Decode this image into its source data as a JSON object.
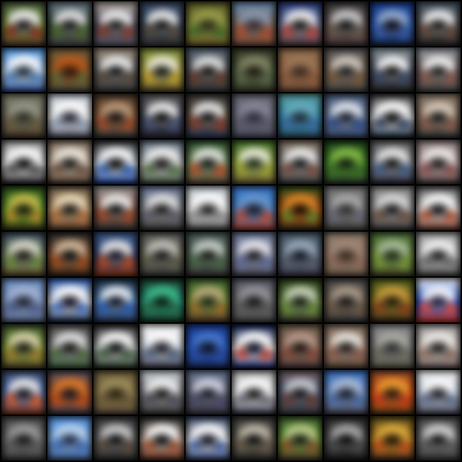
{
  "grid": {
    "rows": 10,
    "cols": 10,
    "background": "#000000",
    "tiles": [
      {
        "top": "#4a5a3a",
        "mid": "#6a8a3a",
        "bottom": "#5a3a2a",
        "blob": "#f2f2f2",
        "dark": "#1a1a1a",
        "accent": "#8a2a1a"
      },
      {
        "top": "#6a7a8a",
        "mid": "#3a4a3a",
        "bottom": "#4a4a4a",
        "blob": "#e8e8e8",
        "dark": "#151515",
        "accent": "#4a6a2a"
      },
      {
        "top": "#b0a8a0",
        "mid": "#4a4a5a",
        "bottom": "#5a5a6a",
        "blob": "#f4f4f4",
        "dark": "#1a1a1a",
        "accent": "#8a3a2a"
      },
      {
        "top": "#3a4a6a",
        "mid": "#2a3a4a",
        "bottom": "#3a3a3a",
        "blob": "#f0f0f0",
        "dark": "#101010",
        "accent": "#5a4a3a"
      },
      {
        "top": "#5a5a2a",
        "mid": "#8a8a3a",
        "bottom": "#6a5a2a",
        "blob": "#9aa04a",
        "dark": "#2a2a1a",
        "accent": "#3a6a2a"
      },
      {
        "top": "#6a8ab0",
        "mid": "#7a6a5a",
        "bottom": "#7a4a3a",
        "blob": "#8a9ab0",
        "dark": "#3a2a2a",
        "accent": "#b04a2a"
      },
      {
        "top": "#2a3a7a",
        "mid": "#6a7aa0",
        "bottom": "#5a3a3a",
        "blob": "#f2f2f2",
        "dark": "#151515",
        "accent": "#c04030"
      },
      {
        "top": "#3a3a3a",
        "mid": "#5a4a4a",
        "bottom": "#4a3a3a",
        "blob": "#d0d0d0",
        "dark": "#101010",
        "accent": "#6a5a4a"
      },
      {
        "top": "#1a3a8a",
        "mid": "#2a5ab0",
        "bottom": "#1a2a4a",
        "blob": "#9ab0d0",
        "dark": "#0a0a1a",
        "accent": "#3a5aa0"
      },
      {
        "top": "#4a5a6a",
        "mid": "#4a4a4a",
        "bottom": "#2a2a2a",
        "blob": "#f6f6f6",
        "dark": "#151515",
        "accent": "#6a4a3a"
      },
      {
        "top": "#4a90d8",
        "mid": "#c0d8f0",
        "bottom": "#2a4a8a",
        "blob": "#ffffff",
        "dark": "#1a2a3a",
        "accent": "#4a7ab0"
      },
      {
        "top": "#6a5a3a",
        "mid": "#8a5a2a",
        "bottom": "#4a4a3a",
        "blob": "#c05a1a",
        "dark": "#2a1a10",
        "accent": "#5a6a3a"
      },
      {
        "top": "#a09080",
        "mid": "#5a5a5a",
        "bottom": "#3a3a3a",
        "blob": "#f4f4f4",
        "dark": "#101010",
        "accent": "#5a4a3a"
      },
      {
        "top": "#7a8a3a",
        "mid": "#a09a3a",
        "bottom": "#5a4a2a",
        "blob": "#f0f0e0",
        "dark": "#151510",
        "accent": "#c0a030"
      },
      {
        "top": "#5a6a7a",
        "mid": "#4a4a4a",
        "bottom": "#3a3a3a",
        "blob": "#e8e8e8",
        "dark": "#101010",
        "accent": "#6a3a2a"
      },
      {
        "top": "#3a3a2a",
        "mid": "#4a5a3a",
        "bottom": "#3a3a2a",
        "blob": "#8a8a6a",
        "dark": "#1a1a10",
        "accent": "#5a6a4a"
      },
      {
        "top": "#8a6a4a",
        "mid": "#9a6a4a",
        "bottom": "#6a4a3a",
        "blob": "#a07a5a",
        "dark": "#3a2a20",
        "accent": "#8a5a3a"
      },
      {
        "top": "#5a5a5a",
        "mid": "#6a5a4a",
        "bottom": "#4a4a4a",
        "blob": "#d8d0c8",
        "dark": "#1a1a1a",
        "accent": "#7a5a3a"
      },
      {
        "top": "#8a9aa0",
        "mid": "#4a4a5a",
        "bottom": "#2a2a2a",
        "blob": "#ffffff",
        "dark": "#101010",
        "accent": "#3a4a6a"
      },
      {
        "top": "#9aa0a8",
        "mid": "#6a5a5a",
        "bottom": "#4a4a4a",
        "blob": "#f8f8f8",
        "dark": "#1a1a1a",
        "accent": "#8a5a4a"
      },
      {
        "top": "#7a7a6a",
        "mid": "#6a6a5a",
        "bottom": "#4a3a2a",
        "blob": "#9a9a8a",
        "dark": "#2a2a20",
        "accent": "#6a5a3a"
      },
      {
        "top": "#c0c8d0",
        "mid": "#f0f0f0",
        "bottom": "#4a4a5a",
        "blob": "#ffffff",
        "dark": "#202030",
        "accent": "#8a9ab0"
      },
      {
        "top": "#4a3a2a",
        "mid": "#8a5a3a",
        "bottom": "#3a3a3a",
        "blob": "#c0a080",
        "dark": "#151010",
        "accent": "#a04a2a"
      },
      {
        "top": "#5a5a5a",
        "mid": "#3a3a4a",
        "bottom": "#2a2a3a",
        "blob": "#f4f4f4",
        "dark": "#0a0a0a",
        "accent": "#4a5a7a"
      },
      {
        "top": "#3a3a3a",
        "mid": "#5a4a3a",
        "bottom": "#2a3a5a",
        "blob": "#f0f0f0",
        "dark": "#101010",
        "accent": "#8a3a2a"
      },
      {
        "top": "#6a6a7a",
        "mid": "#6a6a7a",
        "bottom": "#4a4a5a",
        "blob": "#8a8a9a",
        "dark": "#2a2a3a",
        "accent": "#5a5a6a"
      },
      {
        "top": "#5aa0a0",
        "mid": "#3a8ab0",
        "bottom": "#2a4a5a",
        "blob": "#6ab0c0",
        "dark": "#1a2a3a",
        "accent": "#3a6aa0"
      },
      {
        "top": "#4a5a7a",
        "mid": "#6a7a9a",
        "bottom": "#3a4a6a",
        "blob": "#e8eef4",
        "dark": "#151a2a",
        "accent": "#2a4a8a"
      },
      {
        "top": "#3a3a3a",
        "mid": "#f4f4f4",
        "bottom": "#1a2a3a",
        "blob": "#ffffff",
        "dark": "#0a0a0a",
        "accent": "#2a3a5a"
      },
      {
        "top": "#8a7a6a",
        "mid": "#7a6a5a",
        "bottom": "#3a3a3a",
        "blob": "#e0d0c0",
        "dark": "#151515",
        "accent": "#8a5a4a"
      },
      {
        "top": "#8a8a8a",
        "mid": "#f8f8f8",
        "bottom": "#2a2a2a",
        "blob": "#ffffff",
        "dark": "#0a0a0a",
        "accent": "#4a4a4a"
      },
      {
        "top": "#7a6a5a",
        "mid": "#d0c0b0",
        "bottom": "#4a3a2a",
        "blob": "#f2ece4",
        "dark": "#1a1510",
        "accent": "#6a4a3a"
      },
      {
        "top": "#2a2a2a",
        "mid": "#e0e8f0",
        "bottom": "#1a3a8a",
        "blob": "#ffffff",
        "dark": "#0a0a0a",
        "accent": "#2a5ab0"
      },
      {
        "top": "#5a6a7a",
        "mid": "#d8d8d8",
        "bottom": "#3a4a3a",
        "blob": "#f4f4f4",
        "dark": "#151515",
        "accent": "#4a6a3a"
      },
      {
        "top": "#2a4a2a",
        "mid": "#6a8a5a",
        "bottom": "#5a4a3a",
        "blob": "#e8ece4",
        "dark": "#101a10",
        "accent": "#c04a2a"
      },
      {
        "top": "#3a6a2a",
        "mid": "#8aa03a",
        "bottom": "#6a5a3a",
        "blob": "#f0f0e0",
        "dark": "#1a2a10",
        "accent": "#a0a030"
      },
      {
        "top": "#7a6a5a",
        "mid": "#8a8a8a",
        "bottom": "#3a3a3a",
        "blob": "#f4f4f4",
        "dark": "#151515",
        "accent": "#7a4a3a"
      },
      {
        "top": "#1a3a1a",
        "mid": "#4a8a2a",
        "bottom": "#2a3a2a",
        "blob": "#8ac04a",
        "dark": "#0a1a0a",
        "accent": "#3a6a2a"
      },
      {
        "top": "#5a5a5a",
        "mid": "#8a8a8a",
        "bottom": "#2a2a3a",
        "blob": "#f0f0f0",
        "dark": "#101010",
        "accent": "#3a5a8a"
      },
      {
        "top": "#8a7a7a",
        "mid": "#c0b0b0",
        "bottom": "#4a3a3a",
        "blob": "#f6f0f0",
        "dark": "#1a1515",
        "accent": "#8a4a4a"
      },
      {
        "top": "#2a4a1a",
        "mid": "#5a9a2a",
        "bottom": "#3a3a1a",
        "blob": "#d0c050",
        "dark": "#101a0a",
        "accent": "#c08a2a"
      },
      {
        "top": "#6a5a4a",
        "mid": "#c0a070",
        "bottom": "#5a3a2a",
        "blob": "#f0e0c0",
        "dark": "#1a1510",
        "accent": "#b06a3a"
      },
      {
        "top": "#9a9a9a",
        "mid": "#7a4a3a",
        "bottom": "#3a3a3a",
        "blob": "#f4f4f4",
        "dark": "#101010",
        "accent": "#a04a2a"
      },
      {
        "top": "#6a7a9a",
        "mid": "#8a8a8a",
        "bottom": "#3a3a3a",
        "blob": "#e8e8e8",
        "dark": "#151515",
        "accent": "#5a5a6a"
      },
      {
        "top": "#c0c8d0",
        "mid": "#f0f0f0",
        "bottom": "#4a4a4a",
        "blob": "#ffffff",
        "dark": "#1a1a1a",
        "accent": "#8a8a8a"
      },
      {
        "top": "#3a70c0",
        "mid": "#4a8ad0",
        "bottom": "#a03a2a",
        "blob": "#6a9ad0",
        "dark": "#1a1a2a",
        "accent": "#c04a2a"
      },
      {
        "top": "#2a4a1a",
        "mid": "#c05a1a",
        "bottom": "#3a2a1a",
        "blob": "#e08a2a",
        "dark": "#150a05",
        "accent": "#5a8a2a"
      },
      {
        "top": "#7a7a7a",
        "mid": "#6a6a6a",
        "bottom": "#4a4a4a",
        "blob": "#b0b0b0",
        "dark": "#2a2a2a",
        "accent": "#6a6a7a"
      },
      {
        "top": "#8a8a8a",
        "mid": "#9a9a9a",
        "bottom": "#3a3a3a",
        "blob": "#e0e0e0",
        "dark": "#151515",
        "accent": "#6a4a3a"
      },
      {
        "top": "#5a5a5a",
        "mid": "#e0e0e0",
        "bottom": "#6a3a2a",
        "blob": "#ffffff",
        "dark": "#101010",
        "accent": "#b04a2a"
      },
      {
        "top": "#3a4a5a",
        "mid": "#7a8a6a",
        "bottom": "#5a4a2a",
        "blob": "#e0e0d0",
        "dark": "#151510",
        "accent": "#6a8a3a"
      },
      {
        "top": "#2a2a2a",
        "mid": "#8a5a3a",
        "bottom": "#3a2a1a",
        "blob": "#d8c0a0",
        "dark": "#0a0a0a",
        "accent": "#a04a1a"
      },
      {
        "top": "#3a5a8a",
        "mid": "#2a3a6a",
        "bottom": "#8a3a1a",
        "blob": "#f0f0f0",
        "dark": "#101020",
        "accent": "#c04a1a"
      },
      {
        "top": "#5a5a5a",
        "mid": "#6a6a5a",
        "bottom": "#3a3a3a",
        "blob": "#c8c8c0",
        "dark": "#151515",
        "accent": "#5a5a4a"
      },
      {
        "top": "#4a5a5a",
        "mid": "#4a5a4a",
        "bottom": "#3a3a3a",
        "blob": "#d0d8d0",
        "dark": "#101510",
        "accent": "#4a6a4a"
      },
      {
        "top": "#6a7a9a",
        "mid": "#8a8aa0",
        "bottom": "#4a4a5a",
        "blob": "#f0f0f4",
        "dark": "#151520",
        "accent": "#5a6a9a"
      },
      {
        "top": "#4a5a6a",
        "mid": "#5a6a7a",
        "bottom": "#3a3a4a",
        "blob": "#a0b0c0",
        "dark": "#101520",
        "accent": "#5a5a6a"
      },
      {
        "top": "#8a7a6a",
        "mid": "#9a7a6a",
        "bottom": "#6a5a4a",
        "blob": "#a08a7a",
        "dark": "#3a2a20",
        "accent": "#8a6a5a"
      },
      {
        "top": "#4a6a3a",
        "mid": "#6a8a3a",
        "bottom": "#4a4a2a",
        "blob": "#b0c0a0",
        "dark": "#1a2a10",
        "accent": "#7a9a3a"
      },
      {
        "top": "#a0a0a0",
        "mid": "#c8c8c8",
        "bottom": "#4a4a4a",
        "blob": "#f8f8f8",
        "dark": "#1a1a1a",
        "accent": "#6a6a6a"
      },
      {
        "top": "#6a8ac0",
        "mid": "#8aa0c8",
        "bottom": "#5a6a8a",
        "blob": "#a8b8d8",
        "dark": "#1a2030",
        "accent": "#4a5a8a"
      },
      {
        "top": "#2a5ab0",
        "mid": "#f4f4f4",
        "bottom": "#1a2a4a",
        "blob": "#ffffff",
        "dark": "#0a0a1a",
        "accent": "#3a6ac0"
      },
      {
        "top": "#1a2a3a",
        "mid": "#4a7ab0",
        "bottom": "#2a3a5a",
        "blob": "#f0f4f8",
        "dark": "#0a1020",
        "accent": "#2a5ab0"
      },
      {
        "top": "#1a3a2a",
        "mid": "#2a9a7a",
        "bottom": "#1a3a2a",
        "blob": "#40c090",
        "dark": "#0a1a10",
        "accent": "#2a6a4a"
      },
      {
        "top": "#3a5a2a",
        "mid": "#6a8a3a",
        "bottom": "#5a3a2a",
        "blob": "#c0b080",
        "dark": "#1a2a10",
        "accent": "#a06a2a"
      },
      {
        "top": "#5a5a6a",
        "mid": "#6a6a6a",
        "bottom": "#4a4a4a",
        "blob": "#9a9aa0",
        "dark": "#151515",
        "accent": "#5a5a5a"
      },
      {
        "top": "#2a3a1a",
        "mid": "#6a8a4a",
        "bottom": "#3a3a2a",
        "blob": "#d0d8c0",
        "dark": "#101a0a",
        "accent": "#6a8a3a"
      },
      {
        "top": "#4a4a4a",
        "mid": "#6a5a4a",
        "bottom": "#3a3a3a",
        "blob": "#b0a090",
        "dark": "#151515",
        "accent": "#6a5a4a"
      },
      {
        "top": "#4a5a1a",
        "mid": "#8a7a2a",
        "bottom": "#3a2a1a",
        "blob": "#d0a040",
        "dark": "#1a1a0a",
        "accent": "#8a3a1a"
      },
      {
        "top": "#f0f4f8",
        "mid": "#2a5ad0",
        "bottom": "#c03a2a",
        "blob": "#ffffff",
        "dark": "#1a1a3a",
        "accent": "#e04a3a"
      },
      {
        "top": "#3a4a2a",
        "mid": "#7a9a3a",
        "bottom": "#5a4a2a",
        "blob": "#e0d8b0",
        "dark": "#151a0a",
        "accent": "#a07a2a"
      },
      {
        "top": "#4a4a4a",
        "mid": "#8a8a8a",
        "bottom": "#3a5a3a",
        "blob": "#e8e8e8",
        "dark": "#101010",
        "accent": "#4a6a3a"
      },
      {
        "top": "#2a2a2a",
        "mid": "#d0d0d0",
        "bottom": "#2a3a2a",
        "blob": "#ffffff",
        "dark": "#0a0a0a",
        "accent": "#3a5a3a"
      },
      {
        "top": "#f8f8f8",
        "mid": "#d0d8e0",
        "bottom": "#3a3a4a",
        "blob": "#ffffff",
        "dark": "#151520",
        "accent": "#4a5a7a"
      },
      {
        "top": "#1a3a8a",
        "mid": "#2a5ac0",
        "bottom": "#1a2a5a",
        "blob": "#4a7ad0",
        "dark": "#0a1020",
        "accent": "#2a4aa0"
      },
      {
        "top": "#0a1a4a",
        "mid": "#f0f0f0",
        "bottom": "#1a2a6a",
        "blob": "#ffffff",
        "dark": "#050a20",
        "accent": "#c03a2a"
      },
      {
        "top": "#6a5a4a",
        "mid": "#8a6a5a",
        "bottom": "#4a3a3a",
        "blob": "#c0a090",
        "dark": "#1a1510",
        "accent": "#8a4a3a"
      },
      {
        "top": "#7a6a5a",
        "mid": "#a08070",
        "bottom": "#5a4a3a",
        "blob": "#f0ece8",
        "dark": "#1a1510",
        "accent": "#8a5a4a"
      },
      {
        "top": "#8a8a8a",
        "mid": "#7a7a7a",
        "bottom": "#5a5a4a",
        "blob": "#b0b0a8",
        "dark": "#2a2a2a",
        "accent": "#6a6a5a"
      },
      {
        "top": "#9a9a9a",
        "mid": "#d0c8c0",
        "bottom": "#6a5a5a",
        "blob": "#f4f0ec",
        "dark": "#1a1a1a",
        "accent": "#8a6a5a"
      },
      {
        "top": "#3a4a6a",
        "mid": "#4a6ab0",
        "bottom": "#8a3a1a",
        "blob": "#f0f0f0",
        "dark": "#101020",
        "accent": "#e05a1a"
      },
      {
        "top": "#4a4a5a",
        "mid": "#b05a2a",
        "bottom": "#3a3a4a",
        "blob": "#e07a2a",
        "dark": "#151520",
        "accent": "#c04a1a"
      },
      {
        "top": "#6a5a3a",
        "mid": "#8a7a4a",
        "bottom": "#5a4a3a",
        "blob": "#a09060",
        "dark": "#2a2010",
        "accent": "#6a5a3a"
      },
      {
        "top": "#c8d0d8",
        "mid": "#8a8a8a",
        "bottom": "#3a3a3a",
        "blob": "#f8f8f8",
        "dark": "#151515",
        "accent": "#4a4a5a"
      },
      {
        "top": "#6a7a9a",
        "mid": "#5a5a6a",
        "bottom": "#3a3a4a",
        "blob": "#d8dce8",
        "dark": "#151520",
        "accent": "#4a4a6a"
      },
      {
        "top": "#b0b0b0",
        "mid": "#f0f0f0",
        "bottom": "#3a3a4a",
        "blob": "#ffffff",
        "dark": "#151515",
        "accent": "#6a6a7a"
      },
      {
        "top": "#6a5a5a",
        "mid": "#4a5a7a",
        "bottom": "#3a3a3a",
        "blob": "#d0d0d8",
        "dark": "#101015",
        "accent": "#6a3a2a"
      },
      {
        "top": "#3a70c0",
        "mid": "#6a8ac0",
        "bottom": "#4a4a5a",
        "blob": "#b0c0d8",
        "dark": "#151a2a",
        "accent": "#4a6aa0"
      },
      {
        "top": "#8a4a2a",
        "mid": "#e05a1a",
        "bottom": "#5a3a1a",
        "blob": "#f0a030",
        "dark": "#2a1510",
        "accent": "#c03a1a"
      },
      {
        "top": "#f0f0f0",
        "mid": "#c0c8d8",
        "bottom": "#4a4a5a",
        "blob": "#ffffff",
        "dark": "#1a1a20",
        "accent": "#5a6a8a"
      },
      {
        "top": "#4a4a4a",
        "mid": "#6a6a6a",
        "bottom": "#3a3a3a",
        "blob": "#a0a0a0",
        "dark": "#151515",
        "accent": "#5a5a5a"
      },
      {
        "top": "#4a8ad8",
        "mid": "#8ab0e0",
        "bottom": "#3a5a8a",
        "blob": "#c0d8f0",
        "dark": "#1a2a4a",
        "accent": "#3a6ab0"
      },
      {
        "top": "#3a3a3a",
        "mid": "#5a5a5a",
        "bottom": "#2a2a2a",
        "blob": "#d0d0d0",
        "dark": "#0a0a0a",
        "accent": "#5a4a3a"
      },
      {
        "top": "#2a2a2a",
        "mid": "#c0b0a0",
        "bottom": "#5a2a1a",
        "blob": "#ffffff",
        "dark": "#0a0a0a",
        "accent": "#a04a2a"
      },
      {
        "top": "#3a4a6a",
        "mid": "#f0f0f0",
        "bottom": "#2a3a6a",
        "blob": "#ffffff",
        "dark": "#101020",
        "accent": "#3a5a9a"
      },
      {
        "top": "#3a3a3a",
        "mid": "#5a5a4a",
        "bottom": "#2a2a2a",
        "blob": "#c8c0b0",
        "dark": "#0a0a0a",
        "accent": "#6a5a4a"
      },
      {
        "top": "#3a5a2a",
        "mid": "#6a9a3a",
        "bottom": "#4a3a2a",
        "blob": "#c0d090",
        "dark": "#101a0a",
        "accent": "#8a4a2a"
      },
      {
        "top": "#2a2a2a",
        "mid": "#4a4a4a",
        "bottom": "#1a1a1a",
        "blob": "#b0b0b0",
        "dark": "#050505",
        "accent": "#4a4a4a"
      },
      {
        "top": "#5a4a1a",
        "mid": "#c08a2a",
        "bottom": "#4a2a1a",
        "blob": "#e0b040",
        "dark": "#1a1005",
        "accent": "#c04a1a"
      },
      {
        "top": "#4a4a4a",
        "mid": "#6a6a6a",
        "bottom": "#3a3a3a",
        "blob": "#d8d8d8",
        "dark": "#101010",
        "accent": "#5a5a5a"
      }
    ]
  }
}
